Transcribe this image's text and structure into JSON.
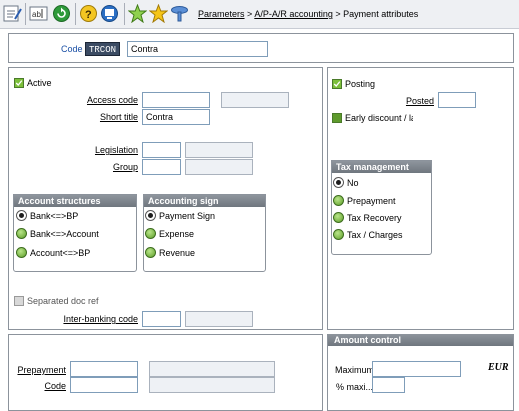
{
  "toolbar": {
    "icons": [
      "text-edit-icon",
      "ab-icon",
      "refresh-icon",
      "help-icon",
      "screen-icon",
      "add-favorite-icon",
      "favorite-icon",
      "link-icon"
    ]
  },
  "breadcrumb": {
    "link1": "Parameters",
    "sep1": ">",
    "link2": "A/P-A/R accounting",
    "sep2": ">",
    "current": "Payment attributes"
  },
  "header": {
    "code_label": "Code",
    "code_value": "TRCON",
    "description": "Contra"
  },
  "left": {
    "active_label": "Active",
    "access_code_label": "Access code",
    "access_code_value": "",
    "short_title_label": "Short title",
    "short_title_value": "Contra",
    "legislation_label": "Legislation",
    "legislation_value": "",
    "group_label": "Group",
    "group_value": "",
    "account_structures": {
      "title": "Account structures",
      "options": [
        "Bank<=>BP",
        "Bank<=>Account",
        "Account<=>BP"
      ],
      "selected": "Bank<=>BP"
    },
    "accounting_sign": {
      "title": "Accounting sign",
      "options": [
        "Payment Sign",
        "Expense",
        "Revenue"
      ],
      "selected": "Payment Sign"
    },
    "separated_doc_ref_label": "Separated doc ref",
    "inter_banking_code_label": "Inter-banking code",
    "inter_banking_code_value": ""
  },
  "right": {
    "posting_label": "Posting",
    "posted_label": "Posted",
    "posted_value": "",
    "early_discount_label": "Early discount / læ",
    "tax_management": {
      "title": "Tax management",
      "options": [
        "No",
        "Prepayment",
        "Tax Recovery",
        "Tax / Charges"
      ],
      "selected": "No"
    }
  },
  "bottom_left": {
    "prepayment_label": "Prepayment",
    "prepayment_value": "",
    "code_label": "Code",
    "code_value": ""
  },
  "amount_control": {
    "title": "Amount control",
    "maximum_label": "Maximum",
    "maximum_value": "",
    "currency": "EUR",
    "percent_max_label": "% maxi...",
    "percent_max_value": ""
  },
  "colors": {
    "label_link_blue": "#1a4fa5",
    "group_header": "#7a8189",
    "radio_green": "#5d9e28",
    "badge_bg": "#3b4b63"
  }
}
